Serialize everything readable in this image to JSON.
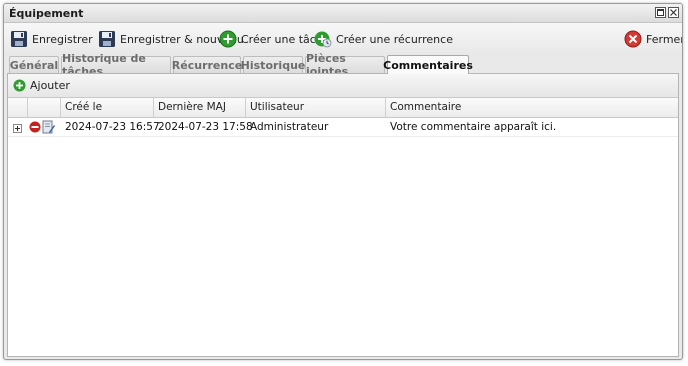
{
  "window": {
    "title": "Équipement"
  },
  "toolbar": {
    "save_label": "Enregistrer",
    "save_new_label": "Enregistrer & nouveau",
    "create_task_label": "Créer une tâche",
    "create_recurrence_label": "Créer une récurrence",
    "close_label": "Fermer"
  },
  "tabs": [
    {
      "label": "Général"
    },
    {
      "label": "Historique de tâches"
    },
    {
      "label": "Récurrence"
    },
    {
      "label": "Historique"
    },
    {
      "label": "Pièces jointes"
    },
    {
      "label": "Commentaires"
    }
  ],
  "active_tab": "Commentaires",
  "comments": {
    "add_label": "Ajouter",
    "columns": [
      "Créé le",
      "Dernière MAJ",
      "Utilisateur",
      "Commentaire"
    ],
    "rows": [
      {
        "created": "2024-07-23 16:57",
        "updated": "2024-07-23 17:58",
        "user": "Administrateur",
        "comment": "Votre commentaire apparaît ici."
      }
    ]
  },
  "colors": {
    "accent_green": "#2e9c2e",
    "delete_red": "#c8201e",
    "window_bg": "#e9e9e9"
  },
  "icons": {
    "save": "floppy-disk-icon",
    "task": "green-plus-circle-icon",
    "recurrence": "recurrence-icon",
    "close": "red-x-circle-icon",
    "add": "green-plus-circle-icon",
    "expand": "plus-square-icon",
    "delete": "red-minus-circle-icon",
    "edit": "document-edit-icon"
  }
}
